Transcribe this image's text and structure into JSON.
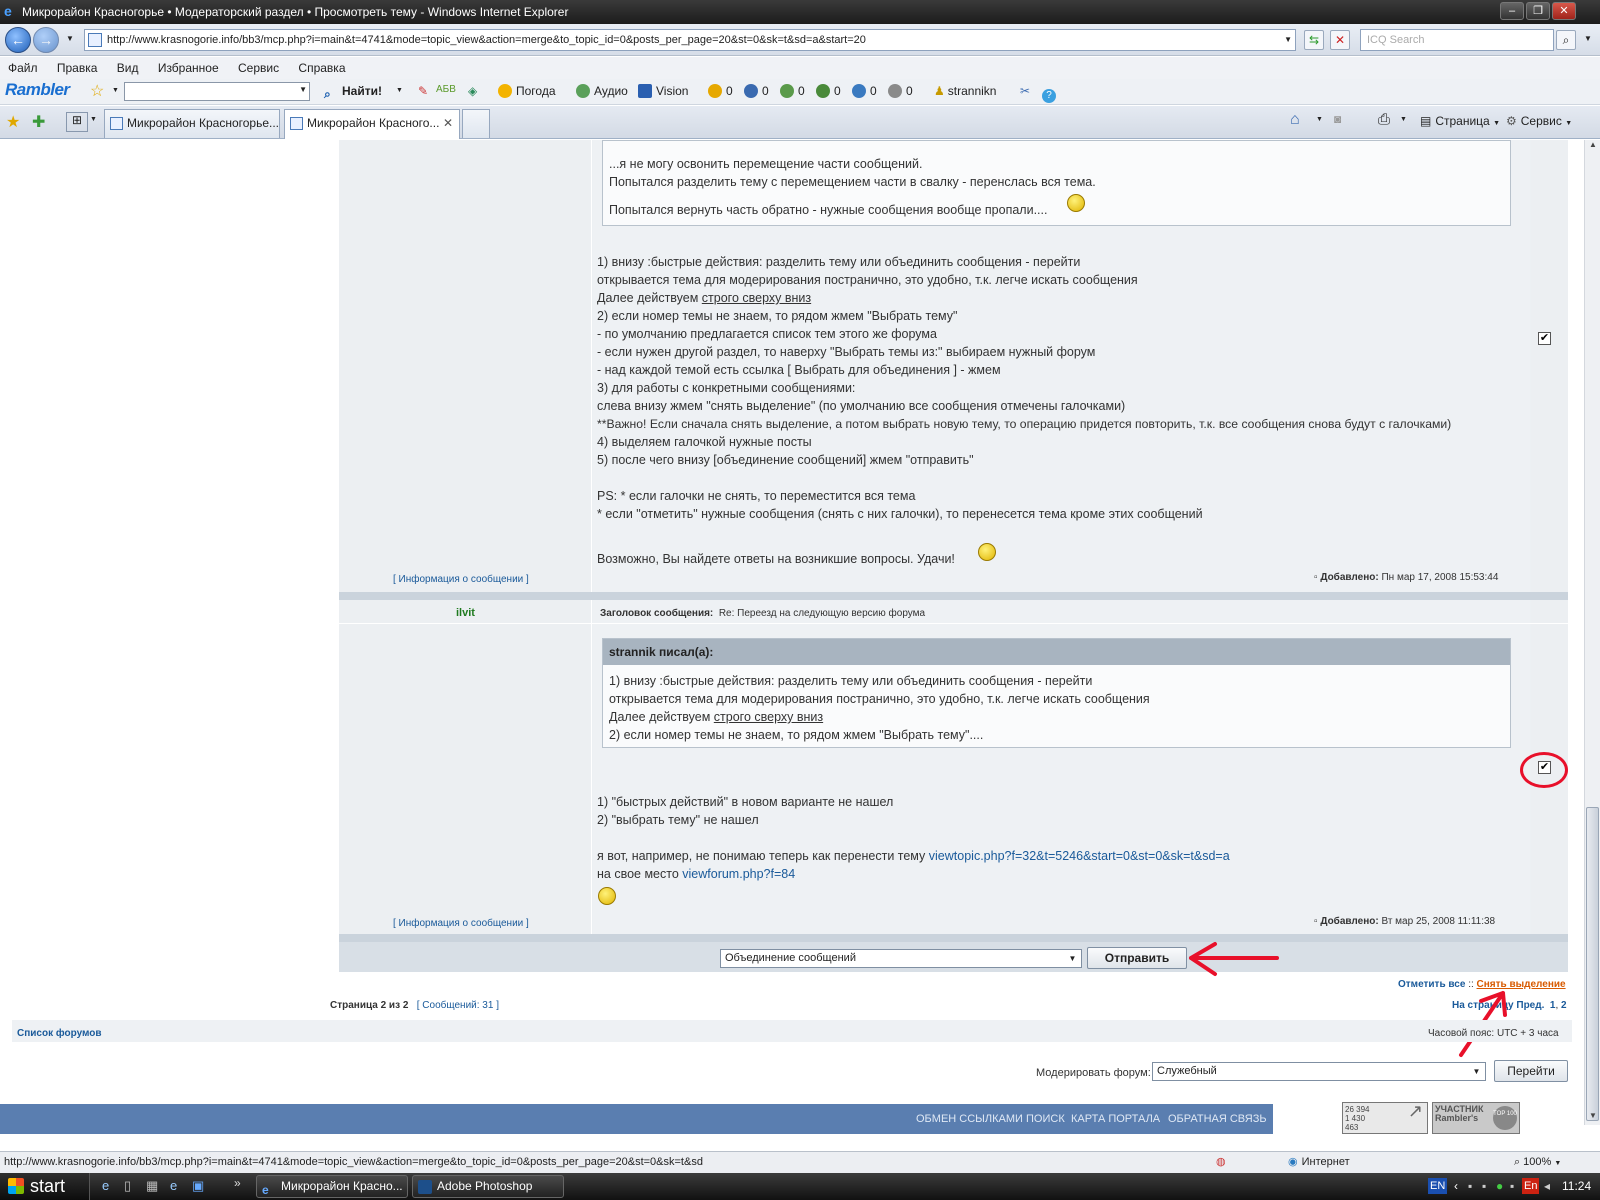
{
  "window": {
    "title": "Микрорайон Красногорье • Модераторский раздел • Просмотреть тему - Windows Internet Explorer"
  },
  "address_bar": {
    "url": "http://www.krasnogorie.info/bb3/mcp.php?i=main&t=4741&mode=topic_view&action=merge&to_topic_id=0&posts_per_page=20&st=0&sk=t&sd=a&start=20",
    "search_placeholder": "ICQ Search"
  },
  "menu": [
    "Файл",
    "Правка",
    "Вид",
    "Избранное",
    "Сервис",
    "Справка"
  ],
  "rambler_toolbar": {
    "logo": "Rambler",
    "find_label": "Найти!",
    "weather": "Погода",
    "audio": "Аудио",
    "vision": "Vision",
    "counters": [
      "0",
      "0",
      "0",
      "0",
      "0",
      "0"
    ],
    "username": "strannikn"
  },
  "tabs": [
    {
      "label": "Микрорайон Красногорье..."
    },
    {
      "label": "Микрорайон Красного..."
    }
  ],
  "command_bar": {
    "page": "Страница",
    "tools": "Сервис"
  },
  "post1": {
    "quote_lines": [
      "...я не могу освонить перемещение части сообщений.",
      "Попытался разделить тему с перемещением части в свалку - перенслась вся тема.",
      "Попытался вернуть часть обратно - нужные сообщения вообще пропали...."
    ],
    "body_lines": [
      "1) внизу :быстрые действия: разделить тему или объединить сообщения - перейти",
      "открывается тема для модерирования постранично, это удобно, т.к. легче искать сообщения",
      "Далее действуем ",
      "строго сверху вниз",
      "2) если номер темы не знаем, то рядом жмем \"Выбрать тему\"",
      "- по умолчанию предлагается список тем этого же форума",
      "- если нужен другой раздел, то наверху \"Выбрать темы из:\" выбираем нужный форум",
      "- над каждой темой есть ссылка [ Выбрать для объединения ] - жмем",
      "3) для работы с конкретными сообщениями:",
      "слева внизу жмем \"снять выделение\" (по умолчанию все сообщения отмечены галочками)",
      "**Важно! Если сначала снять выделение, а потом выбрать новую тему, то операцию придется повторить, т.к. все сообщения снова будут с галочками)",
      "4) выделяем галочкой нужные посты",
      "5) после чего внизу [объединение сообщений] жмем \"отправить\"",
      "PS: * если галочки не снять, то переместится вся тема",
      "* если \"отметить\" нужные сообщения (снять с них галочки), то перенесется тема кроме этих сообщений",
      "Возможно, Вы найдете ответы на возникшие вопросы. Удачи!"
    ],
    "info_link": "[ Информация о сообщении ]",
    "added_label": "Добавлено:",
    "added_date": "Пн мар 17, 2008 15:53:44",
    "checked": true
  },
  "post2": {
    "author": "ilvit",
    "subject_label": "Заголовок сообщения:",
    "subject": "Re: Переезд на следующую версию форума",
    "quote_head": "strannik писал(а):",
    "quote_lines": [
      "1) внизу :быстрые действия: разделить тему или объединить сообщения - перейти",
      "открывается тема для модерирования постранично, это удобно, т.к. легче искать сообщения",
      "Далее действуем ",
      "строго сверху вниз",
      "2) если номер темы не знаем, то рядом жмем \"Выбрать тему\"...."
    ],
    "body_lines": [
      "1) \"быстрых действий\" в новом варианте не нашел",
      "2) \"выбрать тему\" не нашел",
      "я вот, например, не понимаю теперь как перенести тему ",
      "viewtopic.php?f=32&t=5246&start=0&st=0&sk=t&sd=a",
      "на свое место ",
      "viewforum.php?f=84"
    ],
    "info_link": "[ Информация о сообщении ]",
    "added_label": "Добавлено:",
    "added_date": "Вт мар 25, 2008 11:11:38",
    "checked": true
  },
  "actions": {
    "select_value": "Объединение сообщений",
    "submit_label": "Отправить",
    "mark_all": "Отметить все",
    "separator": "::",
    "unmark_all": "Снять выделение"
  },
  "pagination": {
    "page_label": "Страница 2 из 2",
    "posts_count": "[ Сообщений: 31 ]",
    "goto_label": "На страницу",
    "prev": "Пред.",
    "pages": [
      "1",
      "2"
    ]
  },
  "footer": {
    "forum_list": "Список форумов",
    "timezone": "Часовой пояс: UTC + 3 часа",
    "moderate_label": "Модерировать форум:",
    "moderate_value": "Служебный",
    "go_label": "Перейти",
    "links": [
      "ОБМЕН ССЫЛКАМИ",
      "ПОИСК",
      "КАРТА ПОРТАЛА",
      "ОБРАТНАЯ СВЯЗЬ"
    ],
    "counter_lines": [
      "26 394",
      "1 430",
      "463"
    ],
    "badge_top": "УЧАСТНИК",
    "badge_bottom": "Rambler's",
    "badge_top100": "TOP 100"
  },
  "status_bar": {
    "url": "http://www.krasnogorie.info/bb3/mcp.php?i=main&t=4741&mode=topic_view&action=merge&to_topic_id=0&posts_per_page=20&st=0&sk=t&sd",
    "zone": "Интернет",
    "zoom": "100%"
  },
  "taskbar": {
    "start": "start",
    "buttons": [
      "Микрорайон Красно...",
      "Adobe Photoshop"
    ],
    "lang": "EN",
    "lang2": "En",
    "time": "11:24"
  },
  "colors": {
    "annotation_red": "#e8102a",
    "footer_blue": "#5a7eb0",
    "link_blue": "#1a5a9a",
    "author_green": "#1f7a1f"
  }
}
